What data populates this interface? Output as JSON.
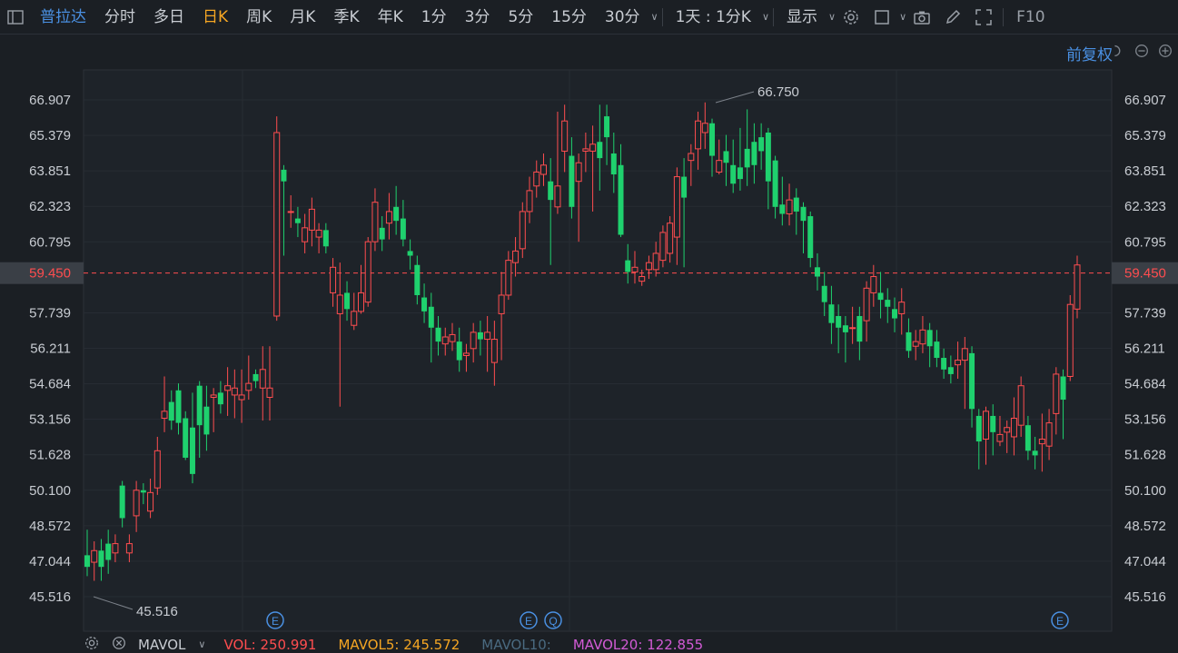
{
  "toolbar": {
    "stock_name": "普拉达",
    "periods": [
      "分时",
      "多日",
      "日K",
      "周K",
      "月K",
      "季K",
      "年K",
      "1分",
      "3分",
      "5分",
      "15分",
      "30分"
    ],
    "active_period": "日K",
    "multi_period": "1天 : 1分K",
    "display": "显示",
    "f10": "F10"
  },
  "adjust_label": "前复权",
  "price_axis": [
    "66.907",
    "65.379",
    "63.851",
    "62.323",
    "60.795",
    "59.450",
    "57.739",
    "56.211",
    "54.684",
    "53.156",
    "51.628",
    "50.100",
    "48.572",
    "47.044",
    "45.516"
  ],
  "current_price": "59.450",
  "high_label": "66.750",
  "low_label": "45.516",
  "event_markers": [
    "E",
    "E",
    "Q",
    "E"
  ],
  "bottom": {
    "indicator": "MAVOL",
    "vol": "VOL: 250.991",
    "mavol5": "MAVOL5: 245.572",
    "mavol10": "MAVOL10:",
    "mavol20": "MAVOL20: 122.855"
  },
  "colors": {
    "up": "#ff4d4f",
    "down": "#1fd16e",
    "accent": "#f5a623",
    "link": "#4a90e2"
  },
  "chart_data": {
    "type": "candlestick",
    "ylim": [
      45.0,
      67.5
    ],
    "candles": [
      [
        47.3,
        46.8,
        48.4,
        46.4
      ],
      [
        47.0,
        47.5,
        47.9,
        46.2
      ],
      [
        47.5,
        46.8,
        48.0,
        46.2
      ],
      [
        47.8,
        47.1,
        48.4,
        46.5
      ],
      [
        47.4,
        47.8,
        48.2,
        47.0
      ],
      [
        50.3,
        48.9,
        50.5,
        48.5
      ],
      [
        47.4,
        47.8,
        48.2,
        47.0
      ],
      [
        49.0,
        50.1,
        50.5,
        48.3
      ],
      [
        50.1,
        50.0,
        50.4,
        49.5
      ],
      [
        49.2,
        50.0,
        50.6,
        48.9
      ],
      [
        50.2,
        51.8,
        52.4,
        49.9
      ],
      [
        53.2,
        53.5,
        55.0,
        52.6
      ],
      [
        53.9,
        53.1,
        54.4,
        52.7
      ],
      [
        54.4,
        53.0,
        54.7,
        52.5
      ],
      [
        53.2,
        51.5,
        53.5,
        51.4
      ],
      [
        52.8,
        50.8,
        54.3,
        50.4
      ],
      [
        54.6,
        52.9,
        54.8,
        51.5
      ],
      [
        53.7,
        52.5,
        54.6,
        51.8
      ],
      [
        54.1,
        54.2,
        54.5,
        52.6
      ],
      [
        54.3,
        53.8,
        54.8,
        53.4
      ],
      [
        54.4,
        54.6,
        55.4,
        53.3
      ],
      [
        54.2,
        54.5,
        55.3,
        53.2
      ],
      [
        54.0,
        54.2,
        55.3,
        53.0
      ],
      [
        54.4,
        54.7,
        55.9,
        54.0
      ],
      [
        55.1,
        54.8,
        55.3,
        54.5
      ],
      [
        54.5,
        55.3,
        56.3,
        53.1
      ],
      [
        54.1,
        54.5,
        56.3,
        53.1
      ],
      [
        57.6,
        65.5,
        66.2,
        57.4
      ],
      [
        63.9,
        63.4,
        64.1,
        60.2
      ],
      [
        62.1,
        62.1,
        62.8,
        61.4
      ],
      [
        61.8,
        61.6,
        62.3,
        61.0
      ],
      [
        60.8,
        61.4,
        62.0,
        60.3
      ],
      [
        61.3,
        62.2,
        62.7,
        60.6
      ],
      [
        61.0,
        61.3,
        61.6,
        60.3
      ],
      [
        61.3,
        60.6,
        61.6,
        60.3
      ],
      [
        58.6,
        59.7,
        60.1,
        58.0
      ],
      [
        57.7,
        58.5,
        59.9,
        53.7
      ],
      [
        58.6,
        57.9,
        59.1,
        57.4
      ],
      [
        57.2,
        57.8,
        58.6,
        57.0
      ],
      [
        57.8,
        58.6,
        59.8,
        57.7
      ],
      [
        58.2,
        60.8,
        61.0,
        58.0
      ],
      [
        60.8,
        62.5,
        63.1,
        60.4
      ],
      [
        61.4,
        60.9,
        61.9,
        60.4
      ],
      [
        61.6,
        62.1,
        62.9,
        60.9
      ],
      [
        62.3,
        61.7,
        63.2,
        61.1
      ],
      [
        61.8,
        60.9,
        62.6,
        60.6
      ],
      [
        60.4,
        60.2,
        60.9,
        59.6
      ],
      [
        59.8,
        58.5,
        60.2,
        58.1
      ],
      [
        58.4,
        57.8,
        59.0,
        57.3
      ],
      [
        58.0,
        57.1,
        58.6,
        55.6
      ],
      [
        57.1,
        56.5,
        57.6,
        55.9
      ],
      [
        56.4,
        56.7,
        57.1,
        55.9
      ],
      [
        56.5,
        56.8,
        57.3,
        56.1
      ],
      [
        56.5,
        55.7,
        57.1,
        55.2
      ],
      [
        55.9,
        56.0,
        56.4,
        55.2
      ],
      [
        56.2,
        56.9,
        57.3,
        55.6
      ],
      [
        56.9,
        56.6,
        57.4,
        55.9
      ],
      [
        56.6,
        56.9,
        57.6,
        55.2
      ],
      [
        55.6,
        56.6,
        57.4,
        54.6
      ],
      [
        57.7,
        58.5,
        59.5,
        55.7
      ],
      [
        58.5,
        60.0,
        60.4,
        58.3
      ],
      [
        59.9,
        60.4,
        61.0,
        59.3
      ],
      [
        60.5,
        62.1,
        62.5,
        60.1
      ],
      [
        62.1,
        63.0,
        63.6,
        61.6
      ],
      [
        63.2,
        63.8,
        64.3,
        62.7
      ],
      [
        63.7,
        64.1,
        64.6,
        63.2
      ],
      [
        63.4,
        62.6,
        64.4,
        59.8
      ],
      [
        62.3,
        63.2,
        66.4,
        62.0
      ],
      [
        64.7,
        66.0,
        66.7,
        63.8
      ],
      [
        64.5,
        62.3,
        65.3,
        61.8
      ],
      [
        63.4,
        64.2,
        64.6,
        60.8
      ],
      [
        64.7,
        64.8,
        65.5,
        63.8
      ],
      [
        64.7,
        65.0,
        65.8,
        62.1
      ],
      [
        65.1,
        64.4,
        66.7,
        63.0
      ],
      [
        66.2,
        65.3,
        66.7,
        64.1
      ],
      [
        64.6,
        63.7,
        65.5,
        62.9
      ],
      [
        64.1,
        61.1,
        65.0,
        61.0
      ],
      [
        60.0,
        59.5,
        60.7,
        59.0
      ],
      [
        59.5,
        59.7,
        60.4,
        59.0
      ],
      [
        59.1,
        59.3,
        59.6,
        58.9
      ],
      [
        59.6,
        59.9,
        60.2,
        59.2
      ],
      [
        59.6,
        60.3,
        60.8,
        59.3
      ],
      [
        60.0,
        61.2,
        61.5,
        59.7
      ],
      [
        60.3,
        61.6,
        61.9,
        59.9
      ],
      [
        61.0,
        63.6,
        64.0,
        59.8
      ],
      [
        63.6,
        62.7,
        64.4,
        59.7
      ],
      [
        64.3,
        64.6,
        65.0,
        63.2
      ],
      [
        64.8,
        66.0,
        66.4,
        63.9
      ],
      [
        65.5,
        65.9,
        66.8,
        64.8
      ],
      [
        65.9,
        64.5,
        66.1,
        63.6
      ],
      [
        63.8,
        64.3,
        65.2,
        63.7
      ],
      [
        64.7,
        64.2,
        65.4,
        63.2
      ],
      [
        64.1,
        63.3,
        65.2,
        62.9
      ],
      [
        64.0,
        63.5,
        65.7,
        63.0
      ],
      [
        64.8,
        64.0,
        66.5,
        63.2
      ],
      [
        65.1,
        64.1,
        65.9,
        63.3
      ],
      [
        65.3,
        64.7,
        65.9,
        63.9
      ],
      [
        65.5,
        63.4,
        65.7,
        62.2
      ],
      [
        64.3,
        62.3,
        64.5,
        61.8
      ],
      [
        62.4,
        62.0,
        63.6,
        61.5
      ],
      [
        62.0,
        62.6,
        63.3,
        61.5
      ],
      [
        62.7,
        62.1,
        63.1,
        61.1
      ],
      [
        62.3,
        61.7,
        62.5,
        60.3
      ],
      [
        61.9,
        60.1,
        62.1,
        59.7
      ],
      [
        59.7,
        59.3,
        60.3,
        58.7
      ],
      [
        58.9,
        58.2,
        59.5,
        57.6
      ],
      [
        58.1,
        57.3,
        58.9,
        56.4
      ],
      [
        57.6,
        57.1,
        58.1,
        56.0
      ],
      [
        57.2,
        56.9,
        57.6,
        55.6
      ],
      [
        57.1,
        57.1,
        58.0,
        56.4
      ],
      [
        57.6,
        56.5,
        58.0,
        55.7
      ],
      [
        57.4,
        58.8,
        59.1,
        56.5
      ],
      [
        58.6,
        59.3,
        59.8,
        58.0
      ],
      [
        58.6,
        58.3,
        59.5,
        57.5
      ],
      [
        58.3,
        58.0,
        58.8,
        57.3
      ],
      [
        57.9,
        57.5,
        58.4,
        56.9
      ],
      [
        57.7,
        58.2,
        58.8,
        56.8
      ],
      [
        56.9,
        56.1,
        57.5,
        55.8
      ],
      [
        56.3,
        56.5,
        57.0,
        55.7
      ],
      [
        56.4,
        57.0,
        57.6,
        56.0
      ],
      [
        57.0,
        56.3,
        57.3,
        55.4
      ],
      [
        56.5,
        55.8,
        57.0,
        55.4
      ],
      [
        55.8,
        55.3,
        56.2,
        54.9
      ],
      [
        55.4,
        55.1,
        55.9,
        54.7
      ],
      [
        55.5,
        55.7,
        56.5,
        54.9
      ],
      [
        55.7,
        56.2,
        56.7,
        53.6
      ],
      [
        56.0,
        53.6,
        56.3,
        52.8
      ],
      [
        53.3,
        52.2,
        53.6,
        51.0
      ],
      [
        52.3,
        53.5,
        53.7,
        51.2
      ],
      [
        53.3,
        52.6,
        53.8,
        51.6
      ],
      [
        52.2,
        52.5,
        53.3,
        52.0
      ],
      [
        52.6,
        52.8,
        53.1,
        51.7
      ],
      [
        52.4,
        53.2,
        54.1,
        51.6
      ],
      [
        52.9,
        54.6,
        55.0,
        52.4
      ],
      [
        52.9,
        51.8,
        53.3,
        51.4
      ],
      [
        51.8,
        51.6,
        52.4,
        51.0
      ],
      [
        52.1,
        52.3,
        53.4,
        50.9
      ],
      [
        52.0,
        53.0,
        53.6,
        51.4
      ],
      [
        53.4,
        55.1,
        55.4,
        52.5
      ],
      [
        55.0,
        54.0,
        55.3,
        52.3
      ],
      [
        55.0,
        58.1,
        58.5,
        54.8
      ],
      [
        57.9,
        59.8,
        60.2,
        57.5
      ]
    ]
  }
}
